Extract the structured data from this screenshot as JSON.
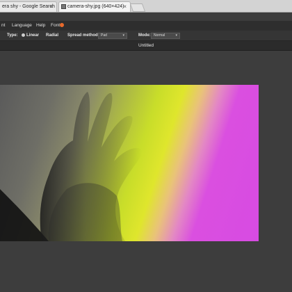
{
  "browser": {
    "tabs": [
      {
        "label": "era shy - Google Search"
      },
      {
        "label": "camera-shy.jpg (640×424)"
      }
    ]
  },
  "menu": {
    "items": [
      "nt",
      "Language",
      "Help",
      "Font"
    ]
  },
  "toolbar": {
    "type_label": "Type:",
    "linear_label": "Linear",
    "radial_label": "Radial",
    "spread_label": "Spread method:",
    "spread_value": "Pad",
    "mode_label": "Mode:",
    "mode_value": "Normal"
  },
  "document": {
    "title": "Untitled"
  },
  "colors": {
    "gradient_start": "#c8dd2a",
    "gradient_end": "#d74be2"
  }
}
